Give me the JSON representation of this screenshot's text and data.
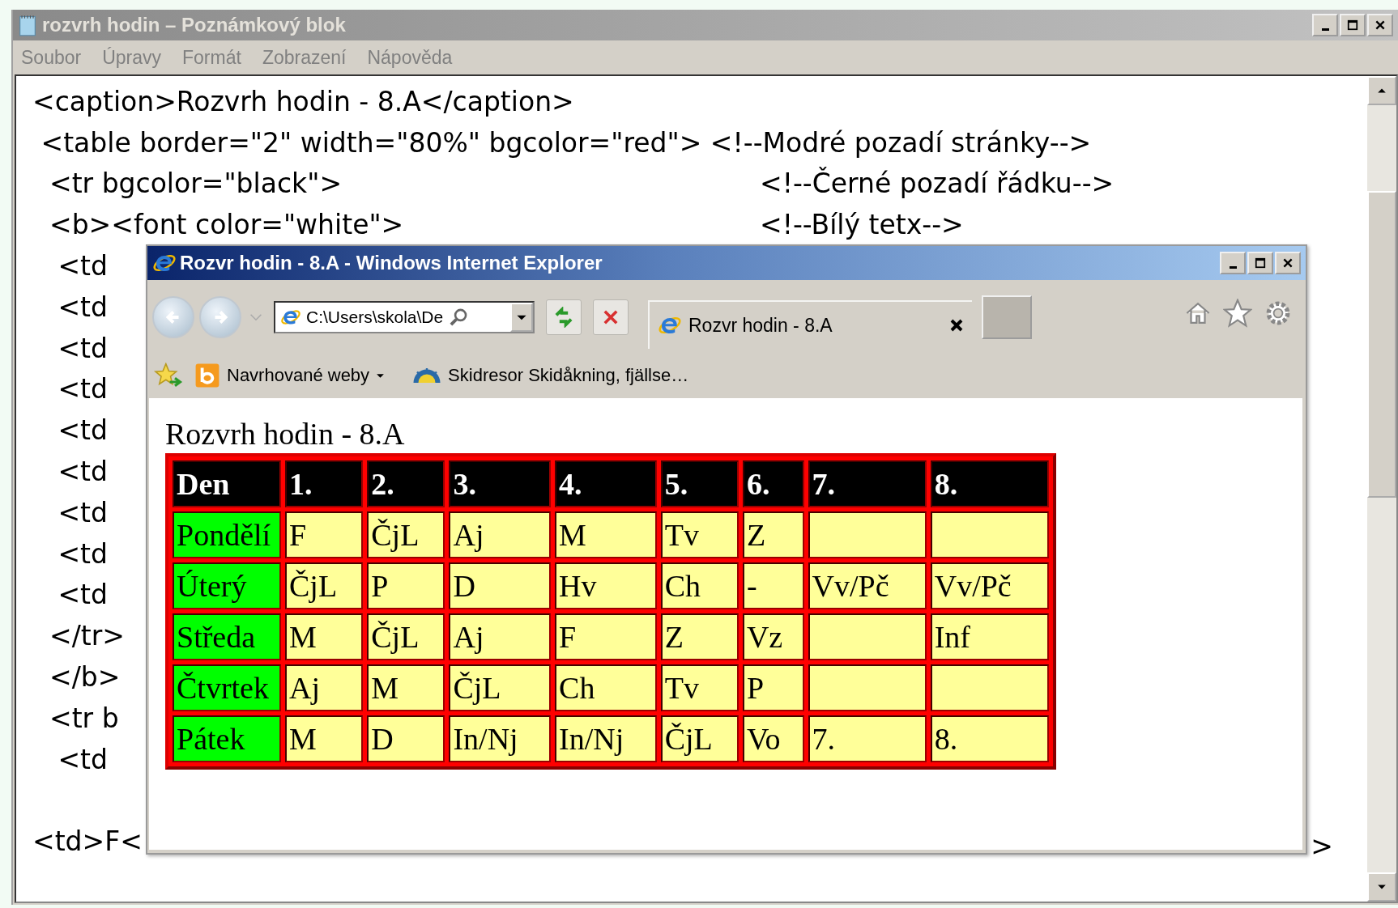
{
  "notepad": {
    "title": "rozvrh hodin – Poznámkový blok",
    "menu": [
      "Soubor",
      "Úpravy",
      "Formát",
      "Zobrazení",
      "Nápověda"
    ],
    "lines": [
      {
        "text": "<caption>Rozvrh hodin - 8.A</caption>"
      },
      {
        "text": " <table border=\"2\" width=\"80%\" bgcolor=\"red\"> <!--Modré pozadí stránky-->"
      },
      {
        "text": "  <tr bgcolor=\"black\">",
        "comment": "<!--Černé pozadí řádku-->"
      },
      {
        "text": "  <b><font color=\"white\">",
        "comment": "<!--Bílý tetx-->"
      },
      {
        "text": "   <td"
      },
      {
        "text": "   <td"
      },
      {
        "text": "   <td"
      },
      {
        "text": "   <td"
      },
      {
        "text": "   <td"
      },
      {
        "text": "   <td"
      },
      {
        "text": "   <td"
      },
      {
        "text": "   <td"
      },
      {
        "text": "   <td"
      },
      {
        "text": "  </tr>"
      },
      {
        "text": "  </b>"
      },
      {
        "text": "  <tr b"
      },
      {
        "text": "   <td"
      }
    ],
    "lines_after_blank": [
      {
        "text": "<td>F<",
        "tail": ">"
      }
    ]
  },
  "browser": {
    "title": "Rozvr hodin - 8.A - Windows Internet Explorer",
    "address": "C:\\Users\\skola\\De",
    "tab": "Rozvr hodin - 8.A",
    "favorites": [
      {
        "label": "Navrhované weby",
        "kind": "suggested",
        "dropdown": true
      },
      {
        "label": "Skidresor Skidåkning, fjällse…",
        "kind": "site",
        "dropdown": false
      }
    ],
    "page": {
      "caption": "Rozvrh hodin - 8.A",
      "table": {
        "columns": [
          "Den",
          "1.",
          "2.",
          "3.",
          "4.",
          "5.",
          "6.",
          "7.",
          "8."
        ],
        "rows": [
          [
            "Pondělí",
            "F",
            "ČjL",
            "Aj",
            "M",
            "Tv",
            "Z",
            null,
            null
          ],
          [
            "Úterý",
            "ČjL",
            "P",
            "D",
            "Hv",
            "Ch",
            "-",
            "Vv/Pč",
            "Vv/Pč"
          ],
          [
            "Středa",
            "M",
            "ČjL",
            "Aj",
            "F",
            "Z",
            "Vz",
            null,
            "Inf"
          ],
          [
            "Čtvrtek",
            "Aj",
            "M",
            "ČjL",
            "Ch",
            "Tv",
            "P",
            null,
            null
          ],
          [
            "Pátek",
            "M",
            "D",
            "In/Nj",
            "In/Nj",
            "ČjL",
            "Vo",
            "7.",
            "8."
          ]
        ]
      }
    }
  }
}
